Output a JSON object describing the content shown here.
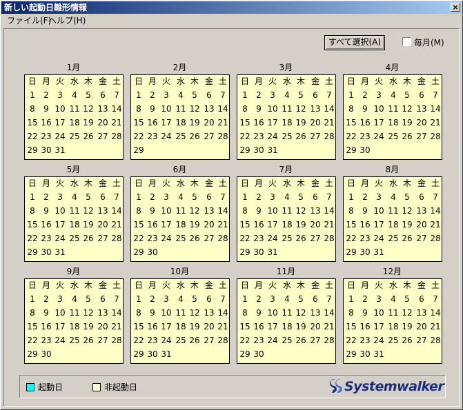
{
  "window": {
    "title": "新しい起動日雛形情報",
    "close_glyph": "×"
  },
  "menubar": [
    {
      "label": "ファイル(F)"
    },
    {
      "label": "ヘルプ(H)"
    }
  ],
  "controls": {
    "select_all_label": "すべて選択(A)",
    "monthly_label": "毎月(M)",
    "monthly_checked": false
  },
  "calendar": {
    "weekdays": [
      "日",
      "月",
      "火",
      "水",
      "木",
      "金",
      "土"
    ],
    "months": [
      {
        "label": "1月",
        "days": 31
      },
      {
        "label": "2月",
        "days": 29
      },
      {
        "label": "3月",
        "days": 31
      },
      {
        "label": "4月",
        "days": 30
      },
      {
        "label": "5月",
        "days": 31
      },
      {
        "label": "6月",
        "days": 30
      },
      {
        "label": "7月",
        "days": 31
      },
      {
        "label": "8月",
        "days": 31
      },
      {
        "label": "9月",
        "days": 30
      },
      {
        "label": "10月",
        "days": 31
      },
      {
        "label": "11月",
        "days": 30
      },
      {
        "label": "12月",
        "days": 31
      }
    ]
  },
  "legend": {
    "start_day_label": "起動日",
    "start_day_color": "#00ffff",
    "non_start_day_label": "非起動日",
    "non_start_day_color": "#ffffc8"
  },
  "logo": {
    "text": "Systemwalker"
  }
}
